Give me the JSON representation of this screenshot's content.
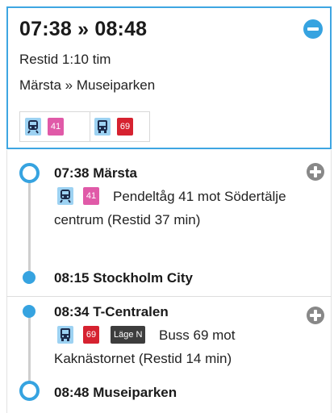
{
  "summary": {
    "times": "07:38 » 08:48",
    "duration": "Restid 1:10 tim",
    "route": "Märsta » Museiparken",
    "legs": [
      {
        "mode_icon": "train-icon",
        "line": "41",
        "color": "#e05aa8"
      },
      {
        "mode_icon": "bus-icon",
        "line": "69",
        "color": "#d62230"
      }
    ]
  },
  "itinerary": {
    "leg1": {
      "departure": "07:38 Märsta",
      "mode_icon": "train-icon",
      "line": "41",
      "description": "Pendeltåg 41 mot Södertälje centrum (Restid 37 min)",
      "arrival": "08:15 Stockholm City"
    },
    "leg2": {
      "departure": "08:34 T-Centralen",
      "mode_icon": "bus-icon",
      "line": "69",
      "position": "Läge N",
      "description": "Buss 69 mot Kaknästornet (Restid 14 min)",
      "arrival": "08:48 Museiparken"
    }
  },
  "colors": {
    "accent": "#36a3e0",
    "pendeltag": "#e05aa8",
    "bus": "#d62230",
    "icon_bg": "#9dd2f2"
  }
}
